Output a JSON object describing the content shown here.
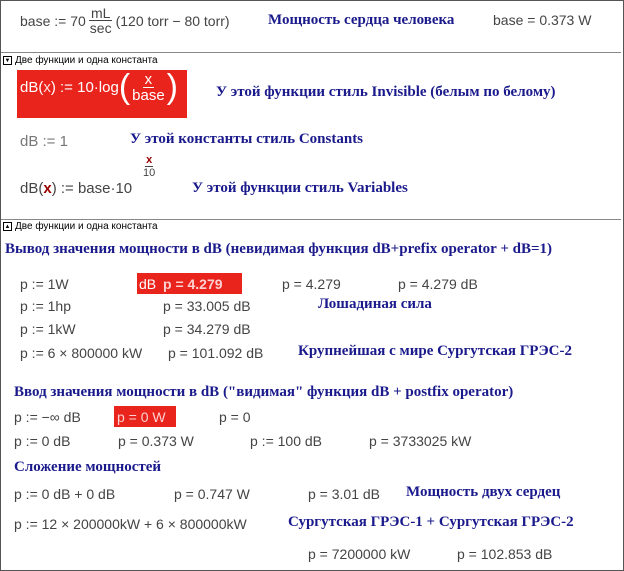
{
  "line1": {
    "left": "base := 70",
    "frac_num": "mL",
    "frac_den": "sec",
    "right": "(120 torr − 80 torr)",
    "title": "Мощность сердца человека",
    "result": "base = 0.373 W"
  },
  "region1": {
    "header": "Две функции и одна константа",
    "fn1_lhs": "dB(",
    "fn1_x": "x",
    "fn1_mid": ") := 10·log",
    "fn1_num": "x",
    "fn1_den": "base",
    "fn1_note": "У этой функции стиль Invisible (белым по белому)",
    "const_expr": "dB := 1",
    "const_note": "У этой константы стиль Constants",
    "fn2_lhs": "dB(",
    "fn2_x": "x",
    "fn2_mid": ") := base·10",
    "fn2_exp_num": "x",
    "fn2_exp_den": "10",
    "fn2_note": "У этой функции стиль Variables"
  },
  "region2": {
    "header": "Две функции и одна константа"
  },
  "section1": {
    "title": "Вывод значения мощности в dB (невидимая функция dB+prefix operator + dB=1)",
    "r1": {
      "a": "p := 1W",
      "b_prefix": "dB",
      "b_val": "p = 4.279",
      "c": "p = 4.279",
      "d": "p = 4.279 dB"
    },
    "r2": {
      "a": "p := 1hp",
      "b": "p = 33.005 dB",
      "note": "Лошадиная сила"
    },
    "r3": {
      "a": "p := 1kW",
      "b": "p = 34.279 dB"
    },
    "r4": {
      "a": "p := 6 × 800000 kW",
      "b": "p = 101.092 dB",
      "note": "Крупнейшая с мире Сургутская ГРЭС-2"
    }
  },
  "section2": {
    "title": "Ввод значения мощности в dB (\"видимая\" функция dB + postfix operator)",
    "r1": {
      "a": "p := −∞ dB",
      "b": "p = 0 W",
      "c": "p = 0"
    },
    "r2": {
      "a": "p := 0 dB",
      "b": "p = 0.373 W",
      "c": "p := 100 dB",
      "d": "p = 3733025 kW"
    }
  },
  "section3": {
    "title": "Сложение мощностей",
    "r1": {
      "a": "p := 0 dB + 0 dB",
      "b": "p = 0.747 W",
      "c": "p = 3.01 dB",
      "note": "Мощность двух сердец"
    },
    "r2": {
      "a": "p := 12 × 200000kW + 6 × 800000kW",
      "note": "Сургутская ГРЭС-1 + Сургутская ГРЭС-2"
    },
    "r3": {
      "a": "p = 7200000 kW",
      "b": "p = 102.853 dB"
    }
  },
  "colors": {
    "highlight": "#e8241c",
    "text_blue": "#1a1a8c",
    "math": "#444444",
    "var_red": "#9b0000"
  }
}
